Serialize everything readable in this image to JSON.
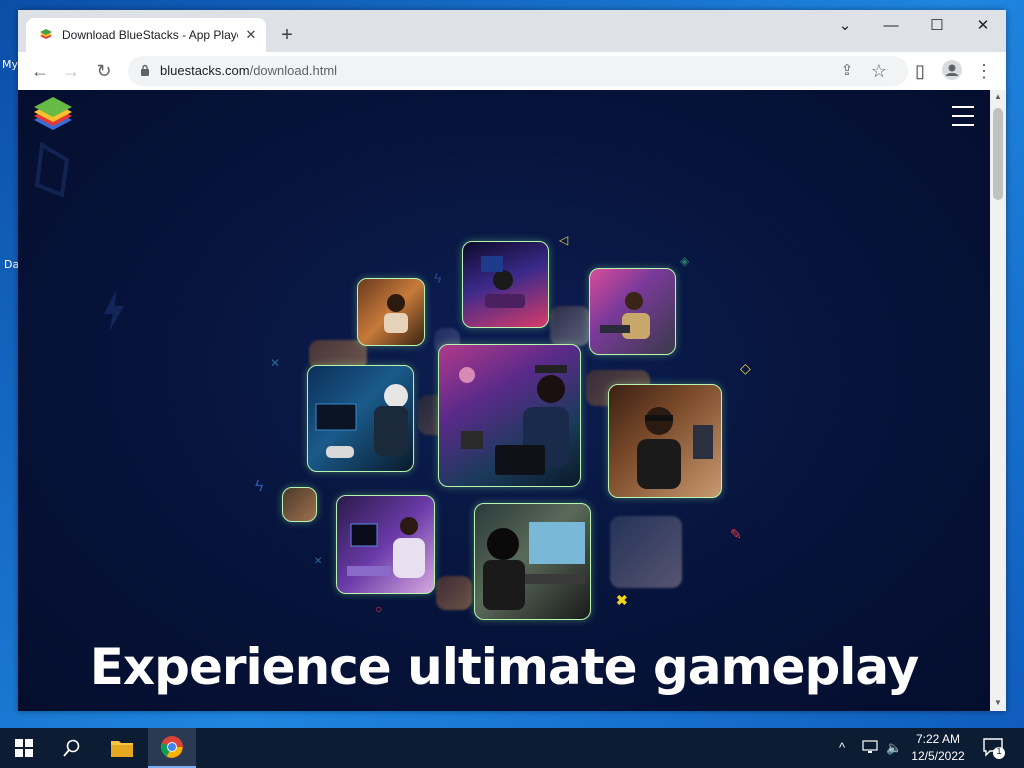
{
  "desktop": {
    "label_1": "My",
    "label_2": "Da"
  },
  "browser": {
    "tab": {
      "title": "Download BlueStacks - App Player",
      "close_symbol": "✕"
    },
    "new_tab_symbol": "+",
    "window_controls": {
      "tab_search": "⌄",
      "minimize": "—",
      "maximize": "☐",
      "close": "✕"
    },
    "toolbar": {
      "back": "←",
      "forward": "→",
      "reload": "↻",
      "url_domain": "bluestacks.com",
      "url_path": "/download.html",
      "share": "⇪",
      "bookmark": "☆",
      "sidepanel": "▯",
      "menu": "⋮"
    }
  },
  "page": {
    "headline": "Experience ultimate gameplay"
  },
  "taskbar": {
    "time": "7:22 AM",
    "date": "12/5/2022",
    "notification_count": "1",
    "icons": [
      "windows-start-icon",
      "search-icon",
      "file-explorer-icon",
      "chrome-icon"
    ]
  },
  "colors": {
    "page_bg": "#06133a",
    "photo_border": "#b8f5b0",
    "taskbar_bg": "#0c1d33",
    "accent_yellow": "#f5d318",
    "accent_red": "#e0394a"
  }
}
